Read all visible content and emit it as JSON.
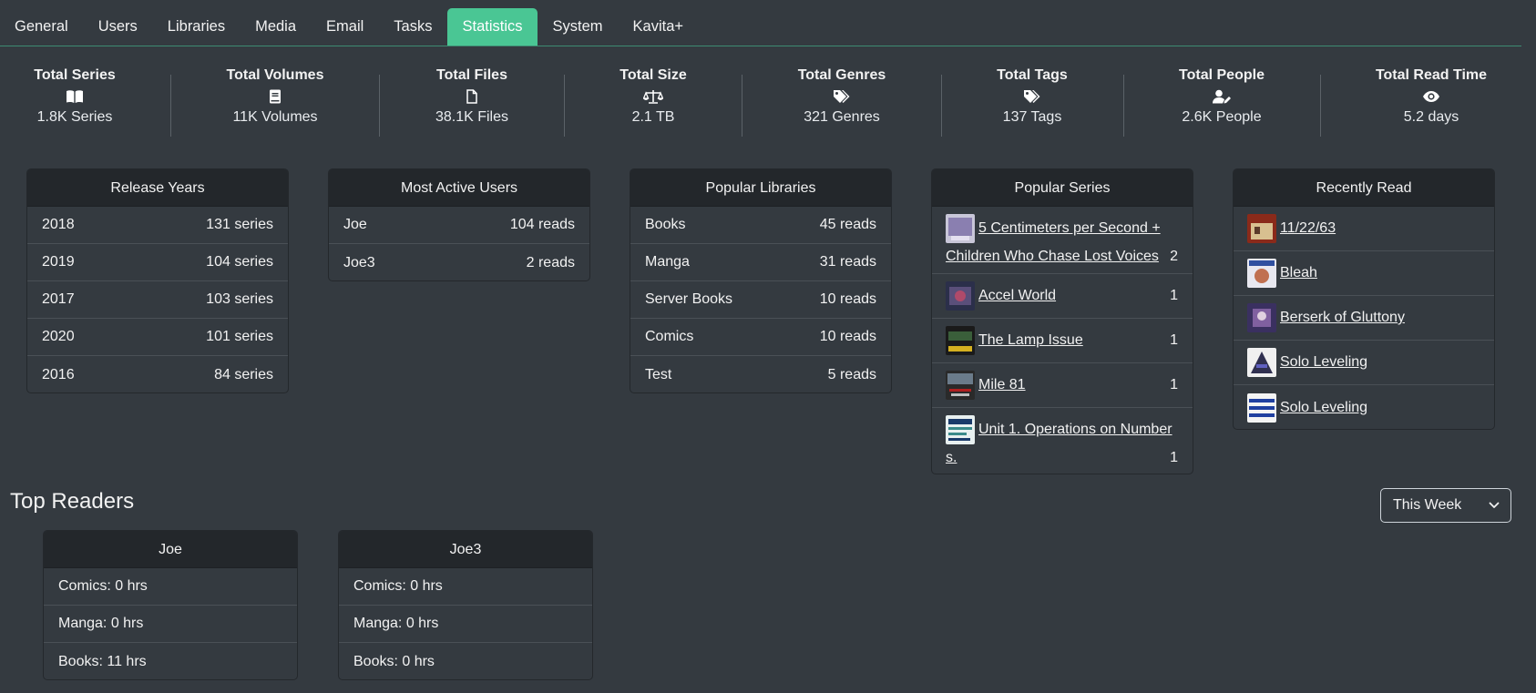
{
  "tabs": [
    "General",
    "Users",
    "Libraries",
    "Media",
    "Email",
    "Tasks",
    "Statistics",
    "System",
    "Kavita+"
  ],
  "active_tab": "Statistics",
  "stats": [
    {
      "title": "Total Series",
      "icon": "book-open-icon",
      "value": "1.8K Series"
    },
    {
      "title": "Total Volumes",
      "icon": "book-icon",
      "value": "11K Volumes"
    },
    {
      "title": "Total Files",
      "icon": "file-icon",
      "value": "38.1K Files"
    },
    {
      "title": "Total Size",
      "icon": "scale-icon",
      "value": "2.1 TB"
    },
    {
      "title": "Total Genres",
      "icon": "tags-icon",
      "value": "321 Genres"
    },
    {
      "title": "Total Tags",
      "icon": "tags-icon",
      "value": "137 Tags"
    },
    {
      "title": "Total People",
      "icon": "user-pen-icon",
      "value": "2.6K People"
    },
    {
      "title": "Total Read Time",
      "icon": "eye-icon",
      "value": "5.2 days"
    }
  ],
  "release_years": {
    "title": "Release Years",
    "rows": [
      {
        "label": "2018",
        "value": "131 series"
      },
      {
        "label": "2019",
        "value": "104 series"
      },
      {
        "label": "2017",
        "value": "103 series"
      },
      {
        "label": "2020",
        "value": "101 series"
      },
      {
        "label": "2016",
        "value": "84 series"
      }
    ]
  },
  "active_users": {
    "title": "Most Active Users",
    "rows": [
      {
        "label": "Joe",
        "value": "104 reads"
      },
      {
        "label": "Joe3",
        "value": "2 reads"
      }
    ]
  },
  "popular_libraries": {
    "title": "Popular Libraries",
    "rows": [
      {
        "label": "Books",
        "value": "45 reads"
      },
      {
        "label": "Manga",
        "value": "31 reads"
      },
      {
        "label": "Server Books",
        "value": "10 reads"
      },
      {
        "label": "Comics",
        "value": "10 reads"
      },
      {
        "label": "Test",
        "value": "5 reads"
      }
    ]
  },
  "popular_series": {
    "title": "Popular Series",
    "rows": [
      {
        "name_line1": " 5 Centimeters per Second +",
        "name_line2": "Children Who Chase Lost Voices",
        "count": "2"
      },
      {
        "name_line1": "Accel World",
        "count": "1"
      },
      {
        "name_line1": " The Lamp Issue",
        "count": "1"
      },
      {
        "name_line1": " Mile 81",
        "count": "1"
      },
      {
        "name_line1": " Unit 1. Operations on Number",
        "name_line2": "s.",
        "count": "1"
      }
    ]
  },
  "recently_read": {
    "title": "Recently Read",
    "rows": [
      " 11/22/63",
      " Bleah",
      " Berserk of Gluttony",
      " Solo Leveling",
      " Solo Leveling"
    ]
  },
  "top_readers": {
    "title": "Top Readers",
    "period": "This Week",
    "readers": [
      {
        "name": "Joe",
        "lines": [
          "Comics: 0 hrs",
          "Manga: 0 hrs",
          "Books: 11 hrs"
        ]
      },
      {
        "name": "Joe3",
        "lines": [
          "Comics: 0 hrs",
          "Manga: 0 hrs",
          "Books: 0 hrs"
        ]
      }
    ]
  }
}
